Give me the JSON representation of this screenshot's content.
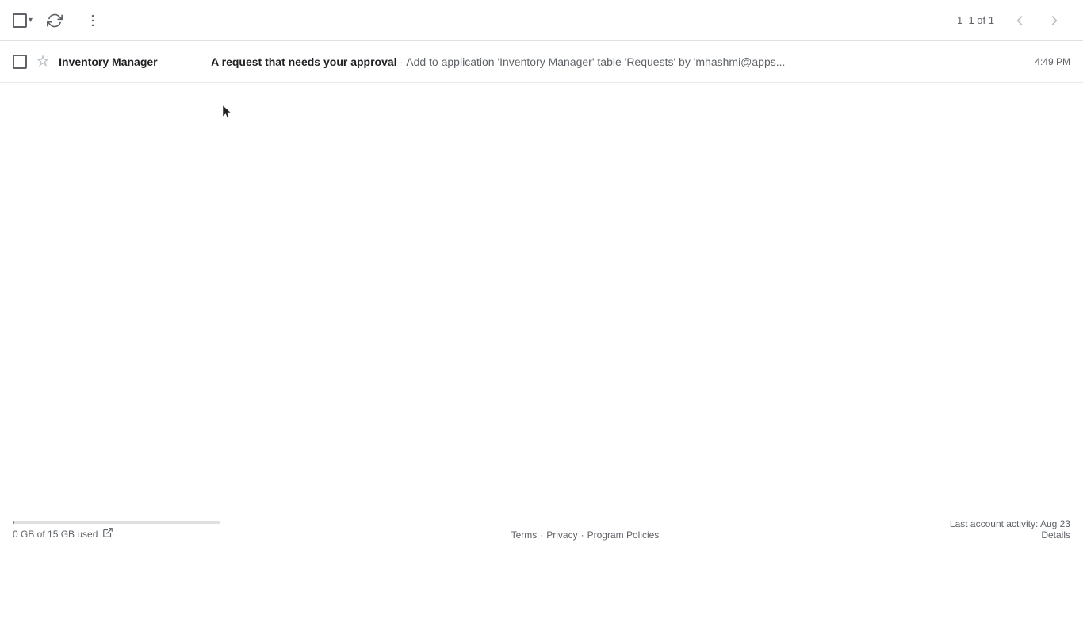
{
  "toolbar": {
    "refresh_title": "Refresh",
    "more_options_title": "More options",
    "pagination": "1–1 of 1",
    "prev_label": "‹",
    "next_label": "›"
  },
  "email": {
    "sender": "Inventory Manager",
    "subject": "A request that needs your approval",
    "preview": " - Add to application 'Inventory Manager' table 'Requests' by 'mhashmi@apps...",
    "time": "4:49 PM"
  },
  "footer": {
    "storage_used": "0 GB of 15 GB used",
    "terms": "Terms",
    "separator1": "·",
    "privacy": "Privacy",
    "separator2": "·",
    "program_policies": "Program Policies",
    "last_activity": "Last account activity: Aug 23",
    "details": "Details"
  }
}
